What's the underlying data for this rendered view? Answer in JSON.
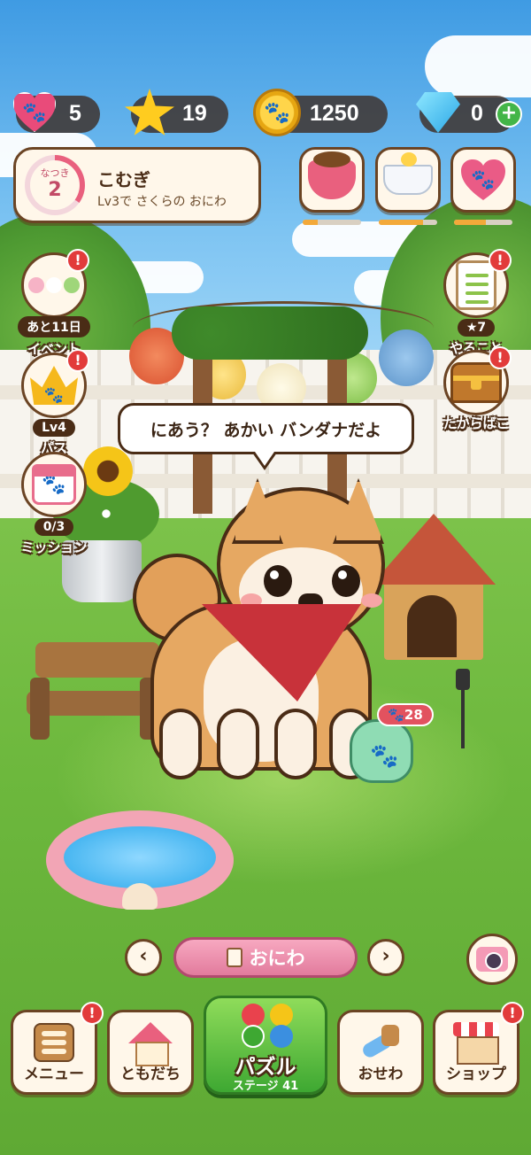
{
  "resources": {
    "hearts": "5",
    "stars": "19",
    "coins": "1250",
    "gems": "0"
  },
  "profile": {
    "bond_label": "なつき",
    "bond_level": "2",
    "name": "こむぎ",
    "subtitle": "Lv3で さくらの おにわ"
  },
  "care": {
    "food_level": 0.25,
    "bath_level": 0.75,
    "affection_level": 0.55
  },
  "left_side": {
    "event": {
      "pill": "あと11日",
      "label": "イベント",
      "alert": "!"
    },
    "pass": {
      "pill": "Lv4",
      "label": "パス",
      "alert": "!"
    },
    "mission": {
      "pill": "0/3",
      "label": "ミッション",
      "alert": "!"
    }
  },
  "right_side": {
    "todo": {
      "pill": "★7",
      "label": "やること",
      "alert": "!"
    },
    "treasure": {
      "label": "たからばこ",
      "alert": "!"
    }
  },
  "speech": "にあう？ あかい バンダナだよ",
  "bag_badge": "28",
  "location": {
    "prev": "‹",
    "name": "おにわ",
    "next": "›"
  },
  "nav": {
    "menu": {
      "label": "メニュー",
      "alert": "!"
    },
    "friends": {
      "label": "ともだち"
    },
    "puzzle": {
      "label": "パズル",
      "sub": "ステージ 41"
    },
    "care": {
      "label": "おせわ"
    },
    "shop": {
      "label": "ショップ",
      "alert": "!"
    }
  },
  "colors": {
    "accent_pink": "#e9607e",
    "alert_red": "#e23b3b",
    "puzzle_green": "#3ea832",
    "frame_brown": "#6b4424"
  }
}
